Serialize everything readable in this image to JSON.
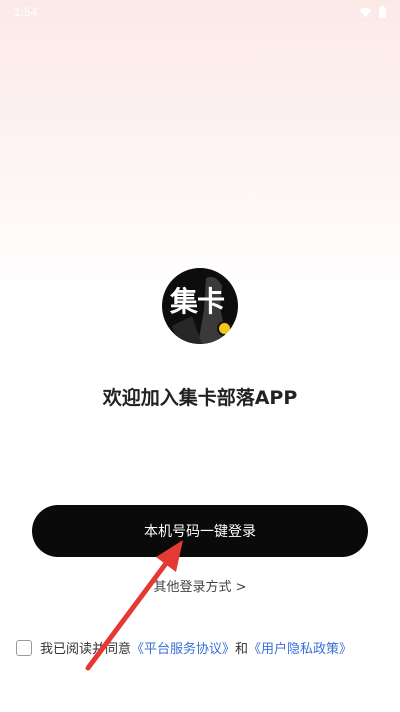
{
  "status_bar": {
    "time": "1:54",
    "icons": [
      "wifi-icon",
      "battery-icon"
    ]
  },
  "logo": {
    "text": "集卡",
    "icon": "app-logo"
  },
  "welcome": {
    "title": "欢迎加入集卡部落APP"
  },
  "login": {
    "button_label": "本机号码一键登录",
    "other_methods": "其他登录方式 >"
  },
  "agreement": {
    "prefix": "我已阅读并同意",
    "service_link": "《平台服务协议》",
    "conjunction": "和",
    "privacy_link": "《用户隐私政策》",
    "checked": false
  },
  "colors": {
    "primary_button": "#0a0a0a",
    "link": "#3a6fd8",
    "annotation_arrow": "#e53935"
  }
}
